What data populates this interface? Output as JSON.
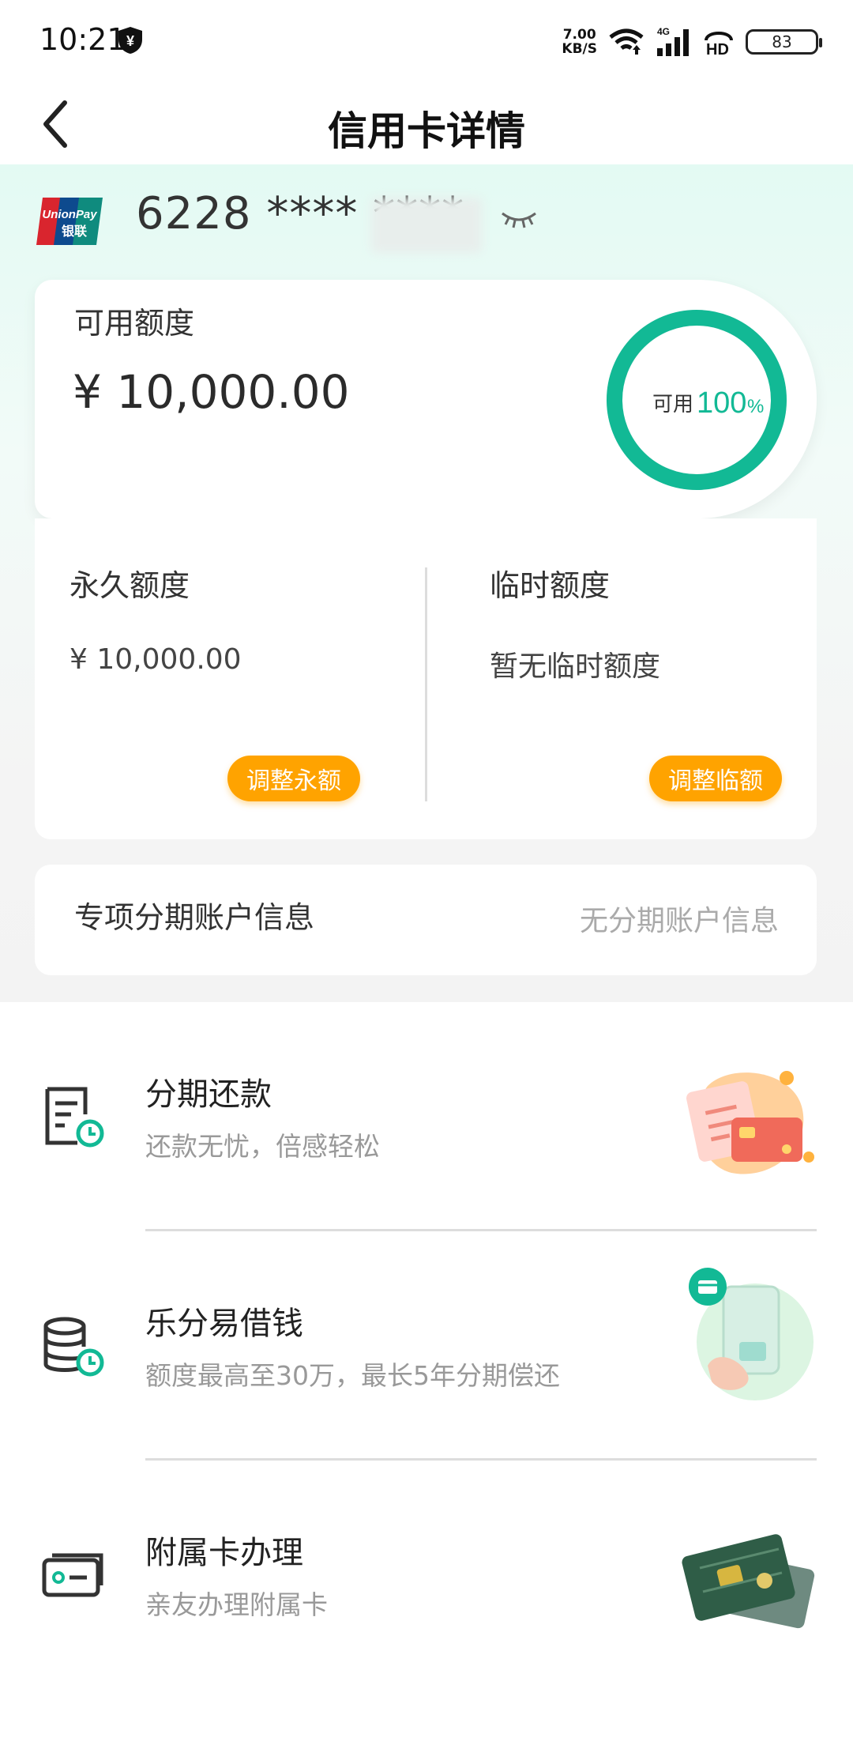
{
  "status_bar": {
    "time": "10:21",
    "speed_value": "7.00",
    "speed_unit": "KB/S",
    "network": "4G",
    "hd": "HD",
    "battery": "83",
    "icons": [
      "shield-yen-icon",
      "wifi-icon",
      "signal-icon",
      "hd-voice-icon",
      "battery-icon"
    ]
  },
  "header": {
    "title": "信用卡详情",
    "back_icon": "chevron-left-icon"
  },
  "card": {
    "brand": "UnionPay 银联",
    "number": "6228 **** ****",
    "eye_icon": "eye-closed-icon"
  },
  "available": {
    "label": "可用额度",
    "amount": "¥ 10,000.00",
    "ring_label": "可用",
    "ring_value": "100",
    "ring_unit": "%",
    "percent_available": 100,
    "ring_color": "#12b995"
  },
  "quota": {
    "permanent_label": "永久额度",
    "permanent_value": "¥ 10,000.00",
    "permanent_button": "调整永额",
    "temporary_label": "临时额度",
    "temporary_value": "暂无临时额度",
    "temporary_button": "调整临额",
    "button_color": "#ffa300"
  },
  "installment_account": {
    "label": "专项分期账户信息",
    "value": "无分期账户信息"
  },
  "services": [
    {
      "title": "分期还款",
      "subtitle": "还款无忧，倍感轻松",
      "icon": "bill-clock-icon",
      "illustration": "bill-card-illustration"
    },
    {
      "title": "乐分易借钱",
      "subtitle": "额度最高至30万，最长5年分期偿还",
      "icon": "coins-clock-icon",
      "illustration": "phone-hand-illustration"
    },
    {
      "title": "附属卡办理",
      "subtitle": "亲友办理附属卡",
      "icon": "card-icon",
      "illustration": "green-cards-illustration"
    }
  ]
}
